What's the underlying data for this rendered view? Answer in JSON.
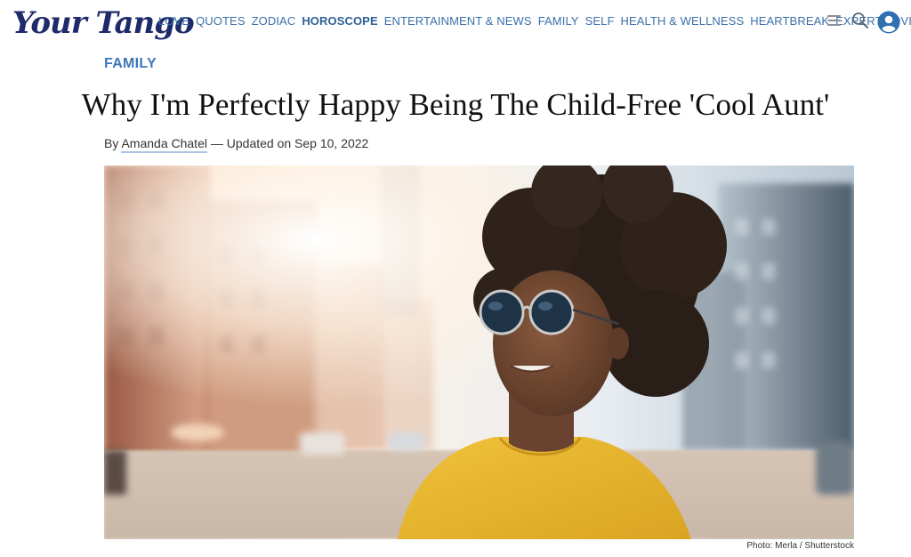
{
  "brand": {
    "logo_text": "Your Tango",
    "logo_color": "#1f2a6b"
  },
  "nav": {
    "items": [
      {
        "label": "LOVE",
        "active": false
      },
      {
        "label": "QUOTES",
        "active": false
      },
      {
        "label": "ZODIAC",
        "active": false
      },
      {
        "label": "HOROSCOPE",
        "active": true
      },
      {
        "label": "ENTERTAINMENT & NEWS",
        "active": false
      },
      {
        "label": "FAMILY",
        "active": false
      },
      {
        "label": "SELF",
        "active": false
      },
      {
        "label": "HEALTH & WELLNESS",
        "active": false
      },
      {
        "label": "HEARTBREAK",
        "active": false
      },
      {
        "label": "EXPERT ADVICE",
        "active": false
      }
    ],
    "menu_icon": "hamburger-menu-icon",
    "search_icon": "search-icon",
    "account_icon": "user-account-icon",
    "accent_color": "#3a6fa8"
  },
  "article": {
    "category": "FAMILY",
    "title": "Why I'm Perfectly Happy Being The Child-Free 'Cool Aunt'",
    "byline": {
      "prefix": "By",
      "author": "Amanda Chatel",
      "separator": "—",
      "updated": "Updated on Sep 10, 2022"
    },
    "hero": {
      "alt": "Smiling woman with curly hair wearing round sunglasses and a yellow shirt on a city street",
      "credit": "Photo: Merla / Shutterstock"
    }
  }
}
